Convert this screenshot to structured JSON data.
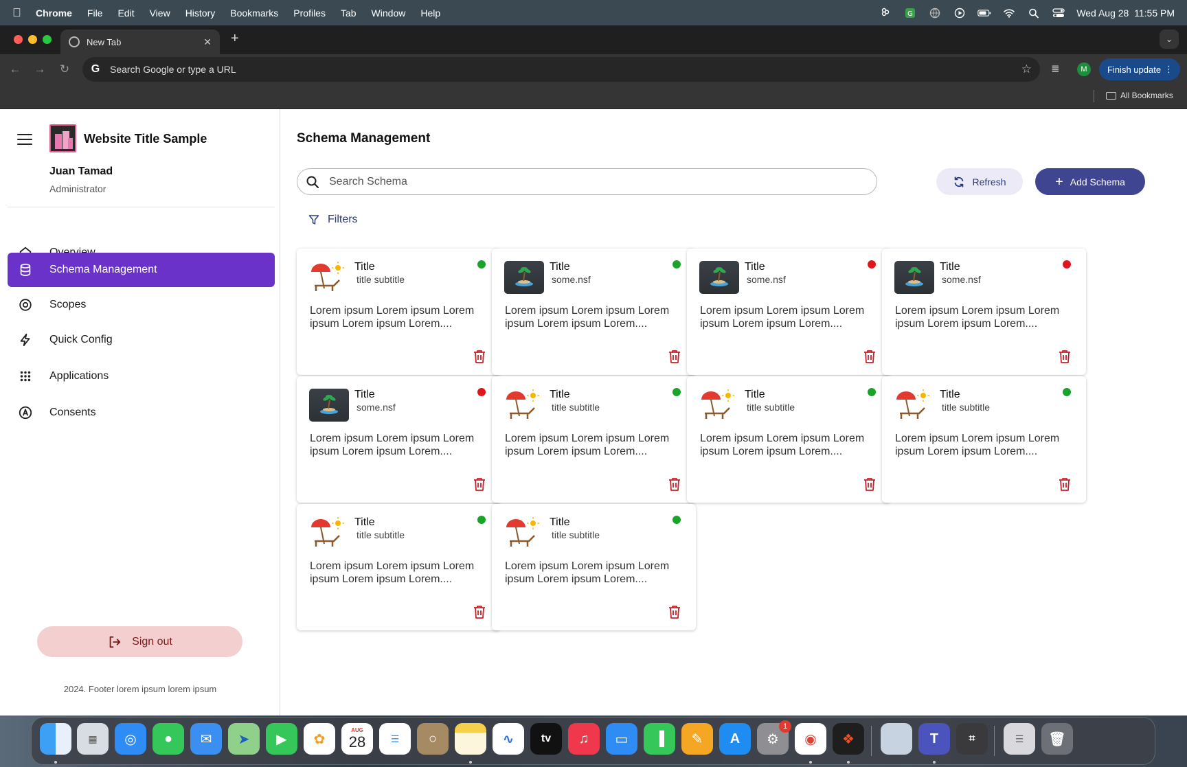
{
  "menubar": {
    "app_name": "Chrome",
    "items": [
      "File",
      "Edit",
      "View",
      "History",
      "Bookmarks",
      "Profiles",
      "Tab",
      "Window",
      "Help"
    ],
    "datetime": "Wed Aug 28  11:55 PM"
  },
  "browser": {
    "tab_title": "New Tab",
    "omnibox_placeholder": "Search Google or type a URL",
    "profile_initial": "M",
    "finish_update_label": "Finish update",
    "all_bookmarks_label": "All Bookmarks"
  },
  "sidebar": {
    "site_title": "Website Title Sample",
    "user_name": "Juan Tamad",
    "user_role": "Administrator",
    "nav": [
      {
        "label": "Overview",
        "icon": "home-icon"
      },
      {
        "label": "Schema Management",
        "icon": "database-icon",
        "active": true
      },
      {
        "label": "Scopes",
        "icon": "target-icon"
      },
      {
        "label": "Quick Config",
        "icon": "lightning-icon"
      },
      {
        "label": "Applications",
        "icon": "grid-icon"
      },
      {
        "label": "Consents",
        "icon": "badge-a-icon"
      }
    ],
    "signout_label": "Sign out",
    "footer": "2024. Footer lorem ipsum lorem ipsum"
  },
  "main": {
    "title": "Schema Management",
    "search_placeholder": "Search Schema",
    "refresh_label": "Refresh",
    "add_label": "Add Schema",
    "filters_label": "Filters"
  },
  "colors": {
    "active_nav": "#6a32c9",
    "primary_button": "#3f4591",
    "status_active": "#1aa329",
    "status_inactive": "#e0141a",
    "trash": "#c8202a"
  },
  "cards": [
    {
      "title": "Title",
      "subtitle": "title subtitle",
      "thumbnail": "beach-umbrella-icon",
      "status": "active",
      "description": "Lorem ipsum Lorem ipsum Lorem ipsum Lorem ipsum Lorem...."
    },
    {
      "title": "Title",
      "subtitle": "some.nsf",
      "thumbnail": "island-photo",
      "status": "active",
      "description": "Lorem ipsum Lorem ipsum Lorem ipsum Lorem ipsum Lorem...."
    },
    {
      "title": "Title",
      "subtitle": "some.nsf",
      "thumbnail": "island-photo",
      "status": "inactive",
      "description": "Lorem ipsum Lorem ipsum Lorem ipsum Lorem ipsum Lorem...."
    },
    {
      "title": "Title",
      "subtitle": "some.nsf",
      "thumbnail": "island-photo",
      "status": "inactive",
      "description": "Lorem ipsum Lorem ipsum Lorem ipsum Lorem ipsum Lorem...."
    },
    {
      "title": "Title",
      "subtitle": "some.nsf",
      "thumbnail": "island-photo",
      "status": "inactive",
      "description": "Lorem ipsum Lorem ipsum Lorem ipsum Lorem ipsum Lorem...."
    },
    {
      "title": "Title",
      "subtitle": "title subtitle",
      "thumbnail": "beach-umbrella-icon",
      "status": "active",
      "description": "Lorem ipsum Lorem ipsum Lorem ipsum Lorem ipsum Lorem...."
    },
    {
      "title": "Title",
      "subtitle": "title subtitle",
      "thumbnail": "beach-umbrella-icon",
      "status": "active",
      "description": "Lorem ipsum Lorem ipsum Lorem ipsum Lorem ipsum Lorem...."
    },
    {
      "title": "Title",
      "subtitle": "title subtitle",
      "thumbnail": "beach-umbrella-icon",
      "status": "active",
      "description": "Lorem ipsum Lorem ipsum Lorem ipsum Lorem ipsum Lorem...."
    },
    {
      "title": "Title",
      "subtitle": "title subtitle",
      "thumbnail": "beach-umbrella-icon",
      "status": "active",
      "description": "Lorem ipsum Lorem ipsum Lorem ipsum Lorem ipsum Lorem...."
    },
    {
      "title": "Title",
      "subtitle": "title subtitle",
      "thumbnail": "beach-umbrella-icon",
      "status": "active",
      "description": "Lorem ipsum Lorem ipsum Lorem ipsum Lorem ipsum Lorem...."
    }
  ],
  "dock": {
    "apps": [
      "finder",
      "launchpad",
      "safari",
      "messages",
      "mail",
      "maps",
      "facetime",
      "photos",
      "calendar",
      "reminders",
      "contacts",
      "notes",
      "freeform",
      "tv",
      "music",
      "keynote",
      "numbers",
      "pages",
      "app-store",
      "system-settings",
      "chrome",
      "figma",
      "preview",
      "teams",
      "calculator",
      "documents",
      "trash"
    ],
    "calendar_month": "AUG",
    "calendar_day": "28",
    "tv_label": "tv",
    "settings_badge": "1"
  }
}
